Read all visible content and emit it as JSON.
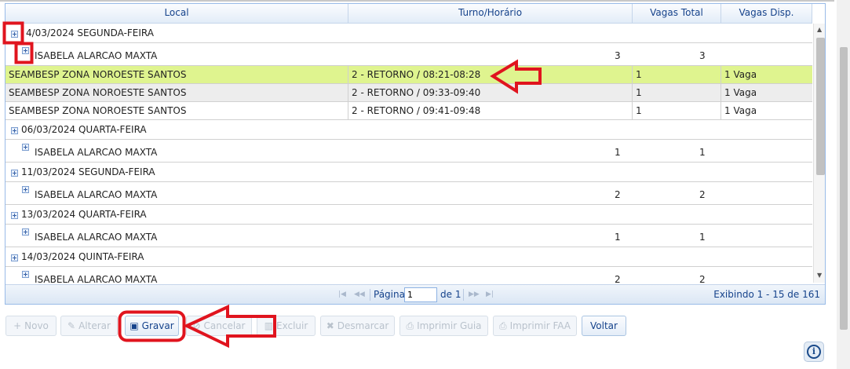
{
  "grid": {
    "columns": [
      {
        "label": "Local"
      },
      {
        "label": "Turno/Horário"
      },
      {
        "label": "Vagas Total"
      },
      {
        "label": "Vagas Disp."
      }
    ],
    "groups": [
      {
        "date_label": "14/03/2024 SEGUNDA-FEIRA",
        "display_label": "4/03/2024 SEGUNDA-FEIRA",
        "person": "ISABELA ALARCAO MAXTA",
        "total": "3",
        "available": "3",
        "rows": [
          {
            "local": "SEAMBESP ZONA NOROESTE SANTOS",
            "turno": "2 - RETORNO / 08:21-08:28",
            "total": "1",
            "disp": "1 Vaga"
          },
          {
            "local": "SEAMBESP ZONA NOROESTE SANTOS",
            "turno": "2 - RETORNO / 09:33-09:40",
            "total": "1",
            "disp": "1 Vaga"
          },
          {
            "local": "SEAMBESP ZONA NOROESTE SANTOS",
            "turno": "2 - RETORNO / 09:41-09:48",
            "total": "1",
            "disp": "1 Vaga"
          }
        ]
      },
      {
        "date_label": "06/03/2024 QUARTA-FEIRA",
        "person": "ISABELA ALARCAO MAXTA",
        "total": "1",
        "available": "1"
      },
      {
        "date_label": "11/03/2024 SEGUNDA-FEIRA",
        "person": "ISABELA ALARCAO MAXTA",
        "total": "2",
        "available": "2"
      },
      {
        "date_label": "13/03/2024 QUARTA-FEIRA",
        "person": "ISABELA ALARCAO MAXTA",
        "total": "1",
        "available": "1"
      },
      {
        "date_label": "14/03/2024 QUINTA-FEIRA",
        "person": "ISABELA ALARCAO MAXTA",
        "total": "2",
        "available": "2"
      }
    ]
  },
  "pager": {
    "page_label": "Página",
    "page_value": "1",
    "of_label": "de 1",
    "display_info": "Exibindo 1 - 15 de 161"
  },
  "toolbar": {
    "novo": "Novo",
    "alterar": "Alterar",
    "gravar": "Gravar",
    "cancelar": "Cancelar",
    "excluir": "Excluir",
    "desmarcar": "Desmarcar",
    "imprimir_guia": "Imprimir Guia",
    "imprimir_faa": "Imprimir FAA",
    "voltar": "Voltar"
  },
  "colors": {
    "selected_row": "#dff48f",
    "annotation_red": "#e0141e",
    "header_text": "#15428b"
  }
}
